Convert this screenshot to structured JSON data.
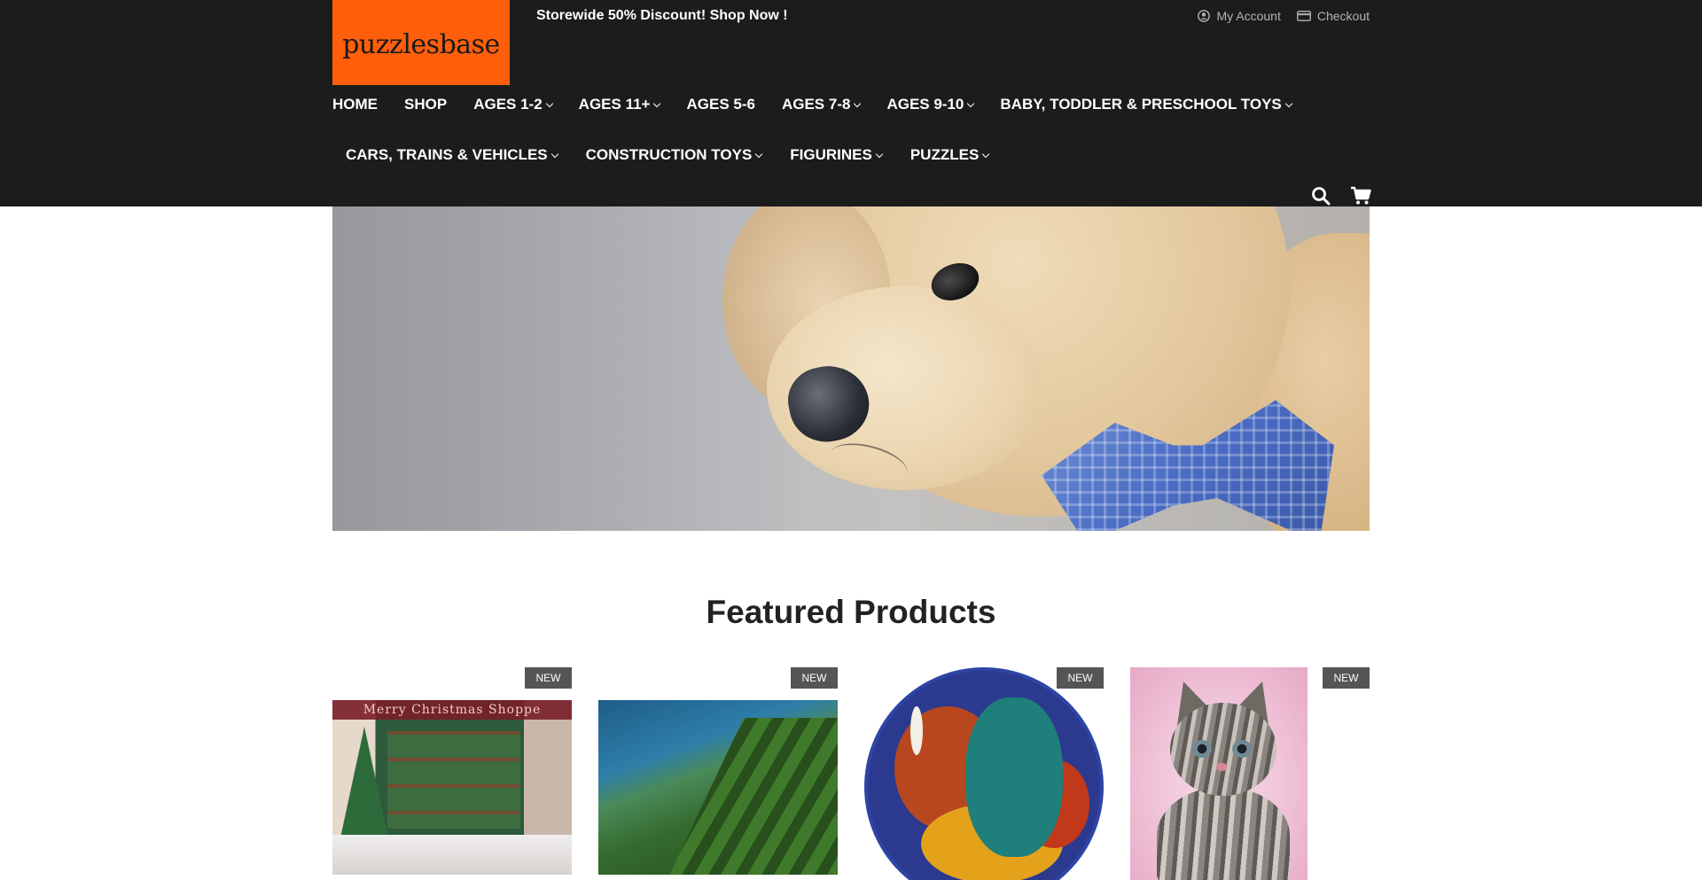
{
  "header": {
    "logo_text": "puzzlesbase",
    "promo": "Storewide 50% Discount! Shop Now !",
    "account_label": "My Account",
    "checkout_label": "Checkout",
    "accent_color": "#ff5f0a",
    "background_color": "#1c1c1c"
  },
  "nav": {
    "row1": [
      {
        "label": "HOME",
        "has_dropdown": false
      },
      {
        "label": "SHOP",
        "has_dropdown": false
      },
      {
        "label": "AGES 1-2",
        "has_dropdown": true
      },
      {
        "label": "AGES 11+",
        "has_dropdown": true
      },
      {
        "label": "AGES 5-6",
        "has_dropdown": false
      },
      {
        "label": "AGES 7-8",
        "has_dropdown": true
      },
      {
        "label": "AGES 9-10",
        "has_dropdown": true
      },
      {
        "label": "BABY, TODDLER & PRESCHOOL TOYS",
        "has_dropdown": true
      }
    ],
    "row2": [
      {
        "label": "CARS, TRAINS & VEHICLES",
        "has_dropdown": true
      },
      {
        "label": "CONSTRUCTION TOYS",
        "has_dropdown": true
      },
      {
        "label": "FIGURINES",
        "has_dropdown": true
      },
      {
        "label": "PUZZLES",
        "has_dropdown": true
      }
    ],
    "icons": [
      "search-icon",
      "cart-icon"
    ]
  },
  "hero": {
    "image": "teddy-bear-photo"
  },
  "featured": {
    "title": "Featured Products",
    "products": [
      {
        "badge": "NEW",
        "image": "christmas-shoppe-puzzle",
        "image_text": "Merry Christmas Shoppe"
      },
      {
        "badge": "NEW",
        "image": "coastline-ridge-puzzle"
      },
      {
        "badge": "NEW",
        "image": "round-folk-art-puzzle"
      },
      {
        "badge": "NEW",
        "image": "kitten-puzzle"
      }
    ]
  }
}
